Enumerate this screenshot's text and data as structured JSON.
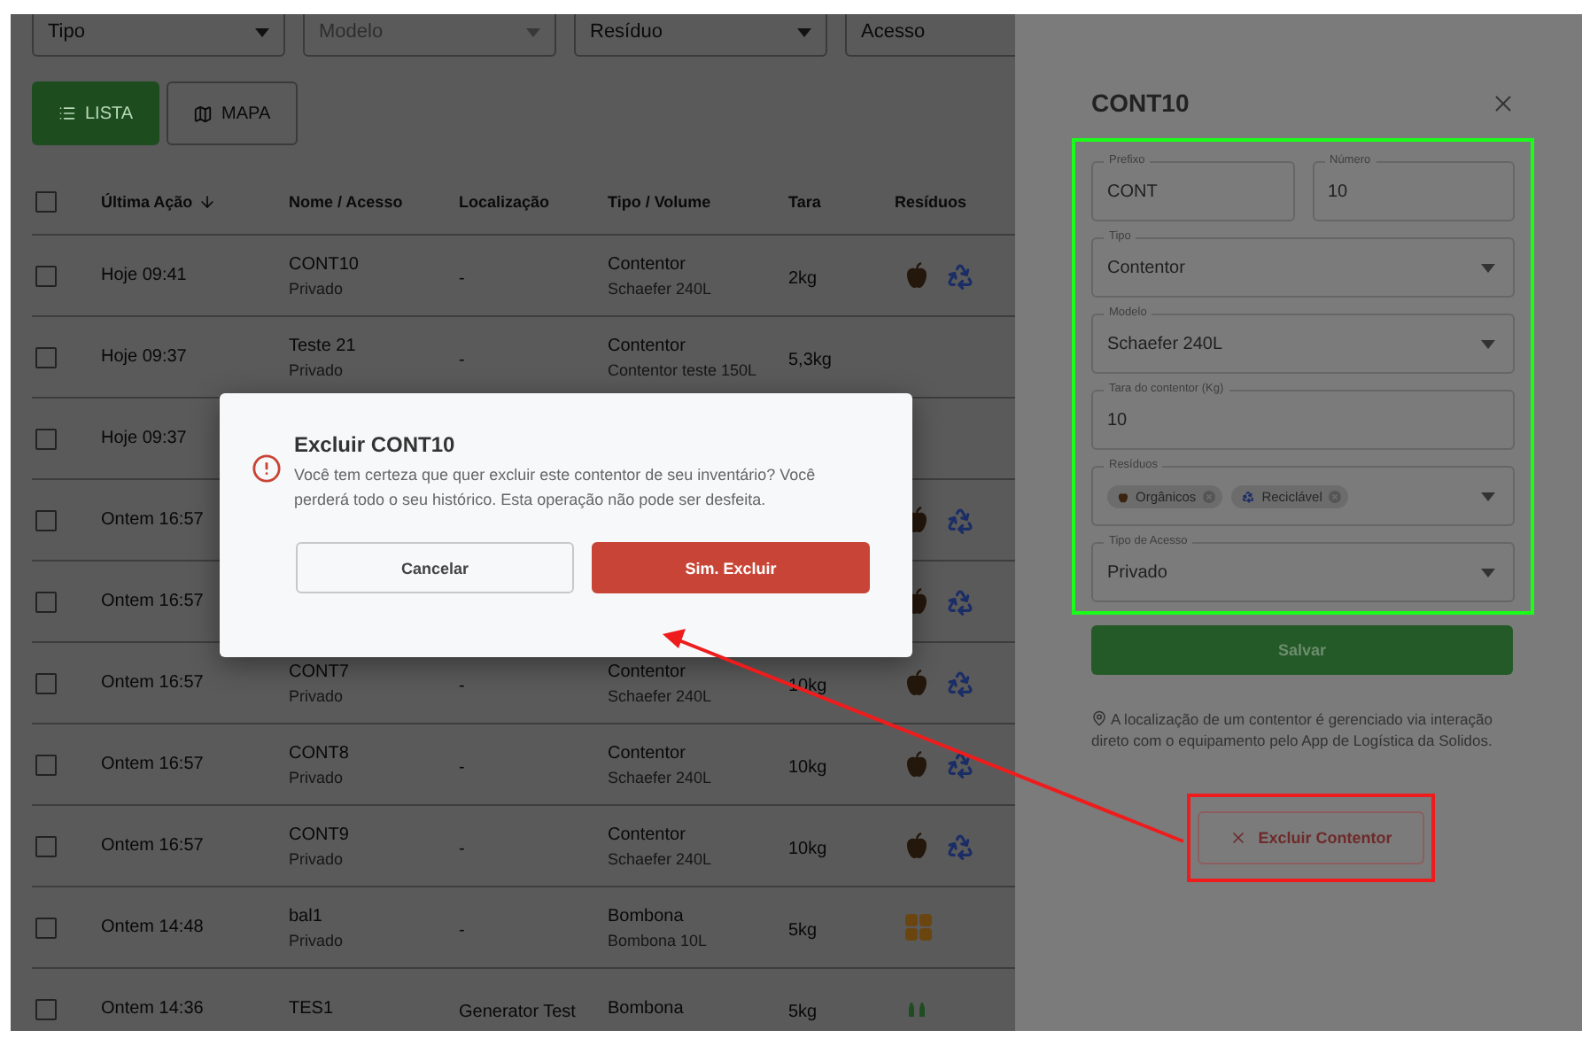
{
  "filters": [
    {
      "placeholder": "Tipo",
      "disabled": false
    },
    {
      "placeholder": "Modelo",
      "disabled": true
    },
    {
      "placeholder": "Resíduo",
      "disabled": false
    },
    {
      "placeholder": "Acesso",
      "disabled": false
    }
  ],
  "view_toggle": [
    {
      "kind": "list",
      "label": "LISTA",
      "selected": true
    },
    {
      "kind": "map",
      "label": "MAPA",
      "selected": false
    }
  ],
  "table": {
    "columns": [
      {
        "label": "Última Ação",
        "sorted": true
      },
      {
        "label": "Nome / Acesso",
        "sorted": false
      },
      {
        "label": "Localização",
        "sorted": false
      },
      {
        "label": "Tipo / Volume",
        "sorted": false
      },
      {
        "label": "Tara",
        "sorted": false
      },
      {
        "label": "Resíduos",
        "sorted": false
      }
    ],
    "header_checked": false,
    "rows": [
      {
        "checked": false,
        "time": "Hoje 09:41",
        "name": "CONT10",
        "access": "Privado",
        "location": "-",
        "type": "Contentor",
        "volume": "Schaefer 240L",
        "tare": "2kg",
        "residues": [
          {
            "kind": "apple"
          },
          {
            "kind": "recycle"
          }
        ]
      },
      {
        "checked": false,
        "time": "Hoje 09:37",
        "name": "Teste 21",
        "access": "Privado",
        "location": "-",
        "type": "Contentor",
        "volume": "Contentor teste 150L",
        "tare": "5,3kg"
      },
      {
        "checked": false,
        "time": "Hoje 09:37"
      },
      {
        "checked": false,
        "time": "Ontem 16:57",
        "residues": [
          {
            "kind": "apple"
          },
          {
            "kind": "recycle"
          }
        ]
      },
      {
        "checked": false,
        "time": "Ontem 16:57",
        "residues": [
          {
            "kind": "apple"
          },
          {
            "kind": "recycle"
          }
        ]
      },
      {
        "checked": false,
        "time": "Ontem 16:57",
        "name": "CONT7",
        "access": "Privado",
        "location": "-",
        "type": "Contentor",
        "volume": "Schaefer 240L",
        "tare": "10kg",
        "residues": [
          {
            "kind": "apple"
          },
          {
            "kind": "recycle"
          }
        ]
      },
      {
        "checked": false,
        "time": "Ontem 16:57",
        "name": "CONT8",
        "access": "Privado",
        "location": "-",
        "type": "Contentor",
        "volume": "Schaefer 240L",
        "tare": "10kg",
        "residues": [
          {
            "kind": "apple"
          },
          {
            "kind": "recycle"
          }
        ]
      },
      {
        "checked": false,
        "time": "Ontem 16:57",
        "name": "CONT9",
        "access": "Privado",
        "location": "-",
        "type": "Contentor",
        "volume": "Schaefer 240L",
        "tare": "10kg",
        "residues": [
          {
            "kind": "apple"
          },
          {
            "kind": "recycle"
          }
        ]
      },
      {
        "checked": false,
        "time": "Ontem 14:48",
        "name": "bal1",
        "access": "Privado",
        "location": "-",
        "type": "Bombona",
        "volume": "Bombona 10L",
        "tare": "5kg",
        "residues": [
          {
            "kind": "blocks"
          }
        ]
      },
      {
        "checked": false,
        "time": "Ontem 14:36",
        "name": "TES1",
        "location": "Generator Test",
        "type": "Bombona",
        "tare": "5kg",
        "residues": [
          {
            "kind": "bottles"
          }
        ]
      }
    ]
  },
  "dialog": {
    "title": "Excluir CONT10",
    "message": "Você tem certeza que quer excluir este contentor de seu inventário? Você perderá todo o seu histórico. Esta operação não pode ser desfeita.",
    "cancel": "Cancelar",
    "confirm": "Sim. Excluir"
  },
  "drawer": {
    "title": "CONT10",
    "fields": [
      {
        "kind": "text",
        "label": "Prefixo",
        "value": "CONT",
        "half": true
      },
      {
        "kind": "text",
        "label": "Número",
        "value": "10",
        "half": true
      },
      {
        "kind": "select",
        "label": "Tipo",
        "value": "Contentor",
        "half": false
      },
      {
        "kind": "select",
        "label": "Modelo",
        "value": "Schaefer 240L",
        "half": false
      },
      {
        "kind": "text",
        "label": "Tara do contentor (Kg)",
        "value": "10",
        "half": false
      },
      {
        "kind": "chips",
        "label": "Resíduos",
        "half": false,
        "chips": [
          {
            "kind": "apple",
            "label": "Orgânicos"
          },
          {
            "kind": "recycle",
            "label": "Reciclável"
          }
        ]
      },
      {
        "kind": "select",
        "label": "Tipo de Acesso",
        "value": "Privado",
        "half": false
      }
    ],
    "save_button": "Salvar",
    "note": "A localização de um contentor é gerenciado via interação direto com o equipamento pelo App de Logística da Solidos.",
    "delete_button": "Excluir Contentor"
  }
}
